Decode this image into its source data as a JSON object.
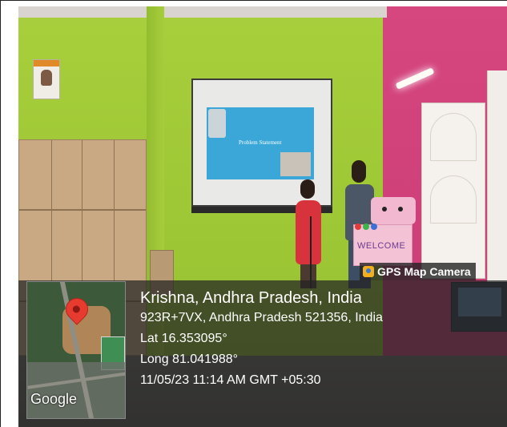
{
  "slide": {
    "title": "Problem Statement"
  },
  "robot_sign": {
    "text": "WELCOME"
  },
  "map": {
    "provider": "Google",
    "pin_icon": "map-pin-icon"
  },
  "gps_badge": {
    "label": "GPS Map Camera",
    "icon": "gps-camera-icon"
  },
  "location": {
    "place": "Krishna, Andhra Pradesh, India",
    "address": "923R+7VX, Andhra Pradesh 521356, India",
    "lat": "Lat 16.353095°",
    "long": "Long 81.041988°",
    "timestamp": "11/05/23 11:14 AM GMT +05:30"
  }
}
